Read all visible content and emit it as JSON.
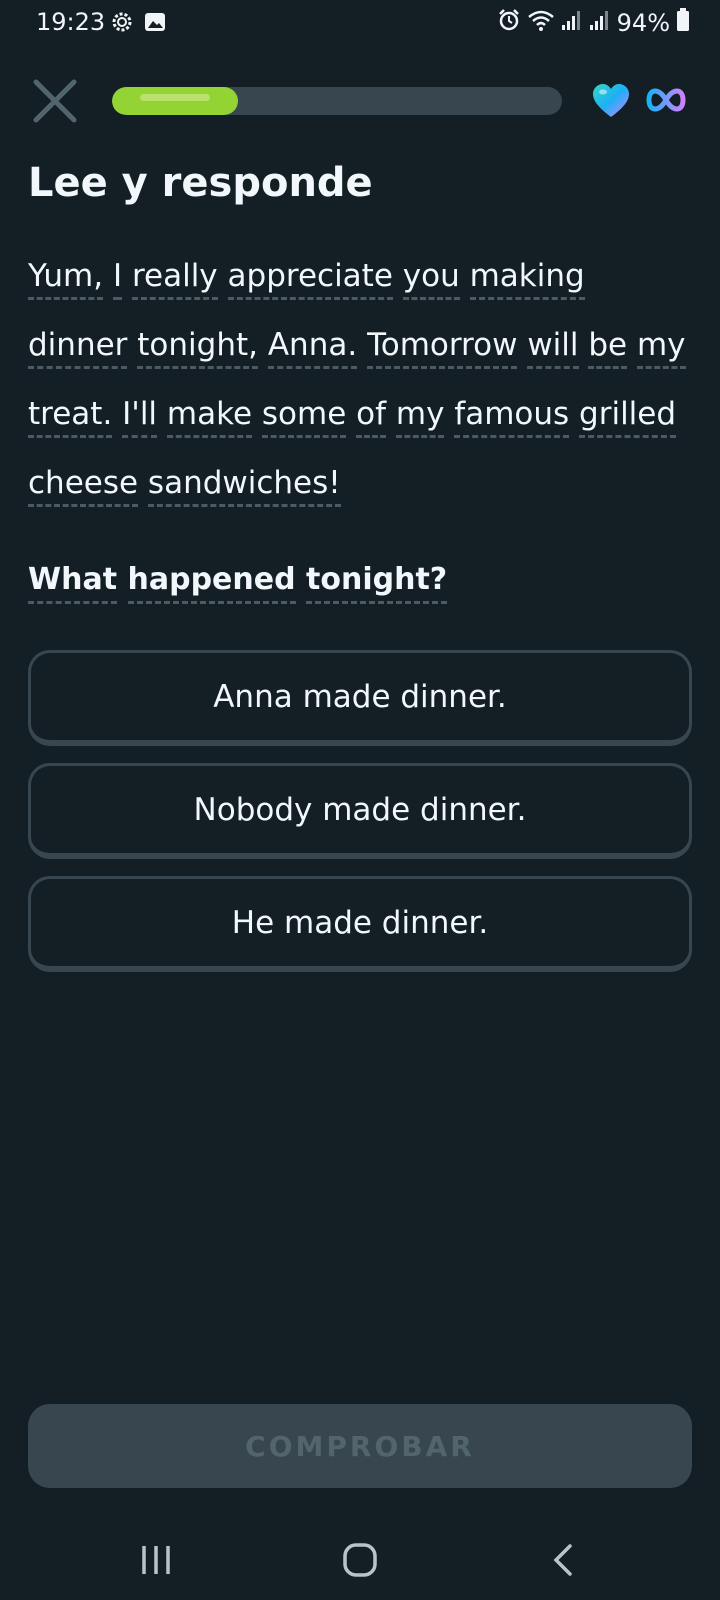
{
  "status_bar": {
    "time": "19:23",
    "battery": "94%",
    "left_icons": [
      "settings-icon",
      "image-icon"
    ],
    "right_icons": [
      "alarm-icon",
      "wifi-icon",
      "signal-icon",
      "signal-icon",
      "battery-icon"
    ]
  },
  "header": {
    "progress": 0.28,
    "heart_icon": "heart-icon",
    "hearts_label": "infinite",
    "colors": {
      "progress": "#93d333",
      "track": "#37464f"
    }
  },
  "exercise": {
    "title": "Lee y responde",
    "passage_words": [
      "Yum,",
      "I",
      "really",
      "appreciate",
      "you",
      "making",
      "dinner",
      "tonight,",
      "Anna.",
      "Tomorrow",
      "will",
      "be",
      "my",
      "treat.",
      "I'll",
      "make",
      "some",
      "of",
      "my",
      "famous",
      "grilled",
      "cheese",
      "sandwiches!"
    ],
    "question_words": [
      "What",
      "happened",
      "tonight?"
    ],
    "options": [
      "Anna made dinner.",
      "Nobody made dinner.",
      "He made dinner."
    ]
  },
  "footer": {
    "check_label": "COMPROBAR"
  },
  "nav": {
    "buttons": [
      "recents-icon",
      "home-icon",
      "back-icon"
    ]
  },
  "colors": {
    "background": "#131f24",
    "border": "#37464f",
    "text": "#f1f7fb"
  }
}
